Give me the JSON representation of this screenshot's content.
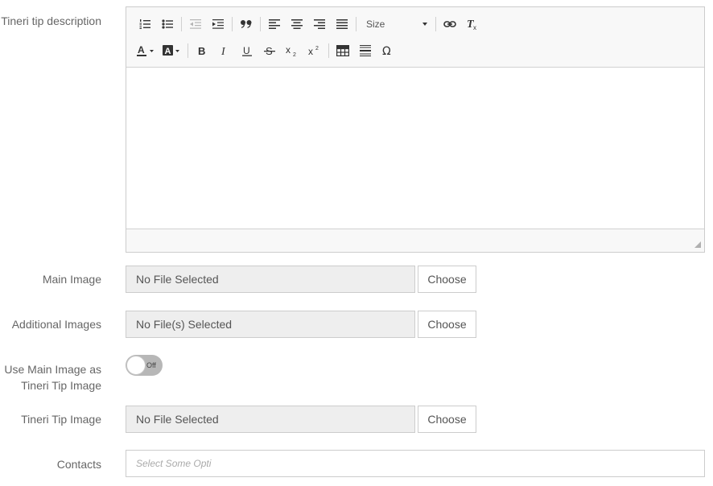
{
  "description": {
    "required_marker": "*",
    "label": "Tineri tip description",
    "size_label": "Size"
  },
  "main_image": {
    "label": "Main Image",
    "value": "No File Selected",
    "button": "Choose"
  },
  "additional_images": {
    "label": "Additional Images",
    "value": "No File(s) Selected",
    "button": "Choose"
  },
  "use_main_image": {
    "label": "Use Main Image as Tineri Tip Image",
    "toggle_text": "Off"
  },
  "tip_image": {
    "label": "Tineri Tip Image",
    "value": "No File Selected",
    "button": "Choose"
  },
  "contacts": {
    "label": "Contacts",
    "placeholder": "Select Some Opti"
  }
}
